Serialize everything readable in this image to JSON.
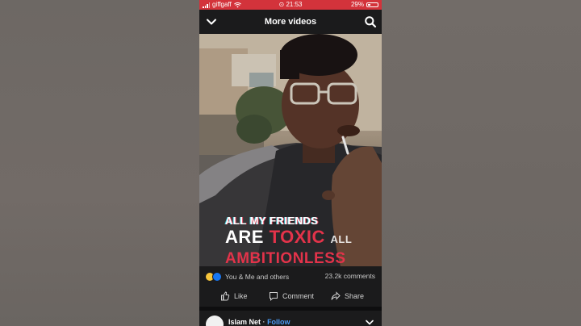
{
  "status_bar": {
    "carrier": "giffgaff",
    "time": "21:53",
    "battery_percent": "29%",
    "battery_level": 0.29,
    "color": "#d3333b"
  },
  "header": {
    "title": "More videos",
    "back_icon": "chevron-down-icon",
    "search_icon": "search-icon"
  },
  "video": {
    "caption_line1": "ALL MY FRIENDS",
    "caption_line2_a": "ARE",
    "caption_line2_b": "TOXIC",
    "caption_line2_c": "ALL",
    "caption_line3": "AMBITIONLESS"
  },
  "engagement": {
    "reactions_text": "You & Me and others",
    "comments_count": "23.2k comments"
  },
  "actions": {
    "like": "Like",
    "comment": "Comment",
    "share": "Share"
  },
  "post": {
    "page_name": "Islam Net",
    "separator": "·",
    "follow_label": "Follow"
  },
  "colors": {
    "accent_blue": "#4a9bf5",
    "caption_red": "#e3334a",
    "app_dark": "#1b1b1c"
  }
}
